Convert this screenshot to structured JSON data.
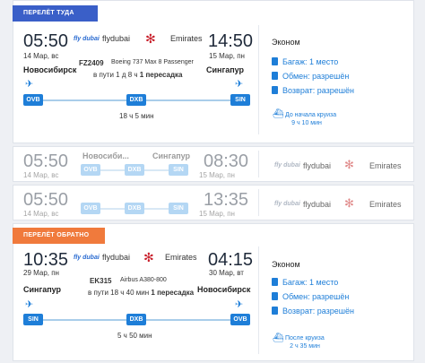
{
  "outbound": {
    "badge": "ПЕРЕЛЁТ ТУДА",
    "dep_time": "05:50",
    "dep_date": "14 Мар, вс",
    "arr_time": "14:50",
    "arr_date": "15 Мар, пн",
    "airline1_logo": "fly dubai",
    "airline1": "flydubai",
    "airline2": "Emirates",
    "flight": "FZ2409",
    "aircraft": "Boeing 737 Max 8 Passenger",
    "duration_stops_prefix": "в пути 1 д 8 ч",
    "stops": "1 пересадка",
    "from_city": "Новосибирск",
    "to_city": "Сингапур",
    "from_code": "OVB",
    "via_code": "DXB",
    "to_code": "SIN",
    "layover": "18 ч 5 мин",
    "class": "Эконом",
    "baggage": "Багаж: 1 место",
    "exchange": "Обмен: разрешён",
    "refund": "Возврат: разрешён",
    "cruise_label": "До начала круиза",
    "cruise_time": "9 ч 10 мин"
  },
  "alt1": {
    "dep_time": "05:50",
    "dep_date": "14 Мар, вс",
    "from_city": "Новосиби...",
    "to_city": "Сингапур",
    "from_code": "OVB",
    "via_code": "DXB",
    "to_code": "SIN",
    "arr_time": "08:30",
    "arr_date": "15 Мар, пн",
    "airline1": "flydubai",
    "airline2": "Emirates"
  },
  "alt2": {
    "dep_time": "05:50",
    "dep_date": "14 Мар, вс",
    "from_code": "OVB",
    "via_code": "DXB",
    "to_code": "SIN",
    "arr_time": "13:35",
    "arr_date": "15 Мар, пн",
    "airline1": "flydubai",
    "airline2": "Emirates"
  },
  "inbound": {
    "badge": "ПЕРЕЛЁТ ОБРАТНО",
    "dep_time": "10:35",
    "dep_date": "29 Мар, пн",
    "arr_time": "04:15",
    "arr_date": "30 Мар, вт",
    "airline1": "flydubai",
    "airline2": "Emirates",
    "flight": "EK315",
    "aircraft": "Airbus A380-800",
    "duration_stops_prefix": "в пути 18 ч 40 мин",
    "stops": "1 пересадка",
    "from_city": "Сингапур",
    "to_city": "Новосибирск",
    "from_code": "SIN",
    "via_code": "DXB",
    "to_code": "OVB",
    "layover": "5 ч 50 мин",
    "class": "Эконом",
    "baggage": "Багаж: 1 место",
    "exchange": "Обмен: разрешён",
    "refund": "Возврат: разрешён",
    "cruise_label": "После круиза",
    "cruise_time": "2 ч 35 мин"
  }
}
